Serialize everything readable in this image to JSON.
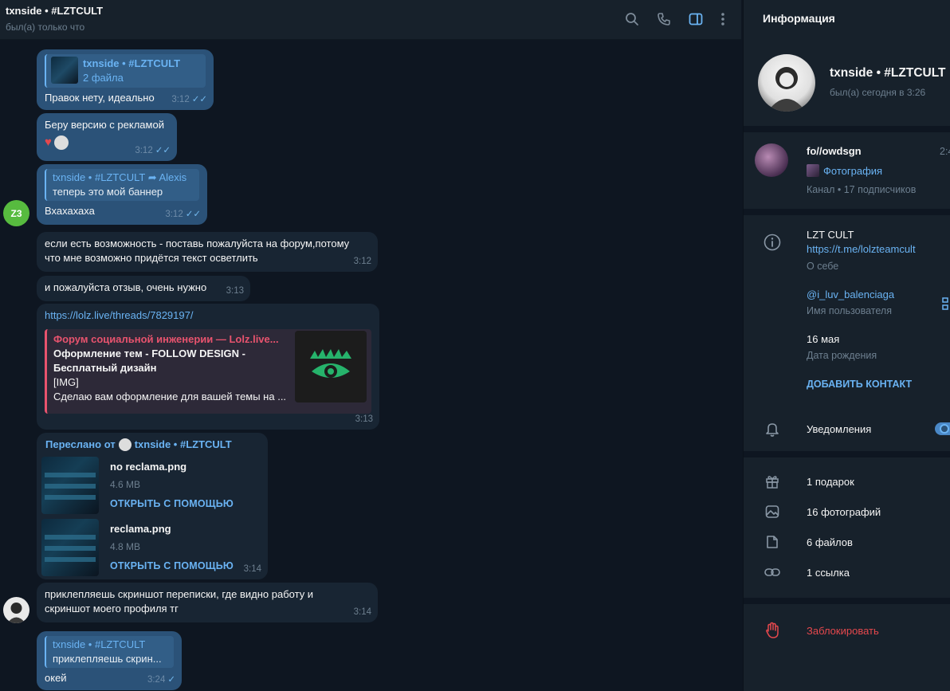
{
  "header": {
    "title": "txnside • #LZTCULT",
    "status": "был(а) только что"
  },
  "messages": {
    "m1": {
      "reply_name": "txnside • #LZTCULT",
      "reply_text": "2 файла",
      "text": "Правок нету, идеально",
      "time": "3:12"
    },
    "m2": {
      "text": "Беру версию с рекламой",
      "time": "3:12",
      "reaction": "♥"
    },
    "m3": {
      "reply_name": "txnside • #LZTCULT",
      "reply_arrow": "➦",
      "reply_to": "Alexis",
      "reply_text": "теперь это мой баннер",
      "text": "Вхахахаха",
      "time": "3:12",
      "avatar": "Z3"
    },
    "m4": {
      "text_line1": "если есть возможность - поставь пожалуйста на форум,потому",
      "text_line2": "что мне возможно придётся текст осветлить",
      "time": "3:12"
    },
    "m5": {
      "text": "и пожалуйста отзыв, очень нужно",
      "time": "3:13"
    },
    "m6": {
      "url": "https://lolz.live/threads/7829197/",
      "site": "Форум социальной инженерии — Lolz.live...",
      "title_line1": "Оформление тем - FOLLOW DESIGN -",
      "title_line2": "Бесплатный дизайн",
      "line3": "[IMG]",
      "line4": "Сделаю вам оформление для вашей темы на ...",
      "time": "3:13"
    },
    "m7": {
      "forward_prefix": "Переслано от",
      "forward_name": "txnside • #LZTCULT",
      "files": [
        {
          "name": "no reclama.png",
          "size": "4.6 MB",
          "action": "ОТКРЫТЬ С ПОМОЩЬЮ"
        },
        {
          "name": "reclama.png",
          "size": "4.8 MB",
          "action": "ОТКРЫТЬ С ПОМОЩЬЮ"
        }
      ],
      "time": "3:14"
    },
    "m8": {
      "text_line1": "приклепляешь скриншот переписки, где видно работу и",
      "text_line2": "скриншот моего профиля тг",
      "time": "3:14"
    },
    "m9": {
      "reply_name": "txnside • #LZTCULT",
      "reply_text": "приклепляешь скрин...",
      "text": "окей",
      "time": "3:24"
    }
  },
  "info": {
    "header": "Информация",
    "name": "txnside • #LZTCULT",
    "status": "был(а) сегодня в 3:26",
    "channel": {
      "name": "fo//owdsgn",
      "time": "2:4",
      "post": "Фотография",
      "meta": "Канал • 17 подписчиков"
    },
    "about": {
      "text": "LZT CULT",
      "link": "https://t.me/lolzteamcult",
      "label": "О себе"
    },
    "username": {
      "value": "@i_luv_balenciaga",
      "label": "Имя пользователя"
    },
    "birthday": {
      "value": "16 мая",
      "label": "Дата рождения"
    },
    "add_contact": "ДОБАВИТЬ КОНТАКТ",
    "notifications": "Уведомления",
    "media": {
      "gifts": "1 подарок",
      "photos": "16 фотографий",
      "files": "6 файлов",
      "links": "1 ссылка"
    },
    "block": "Заблокировать"
  },
  "colors": {
    "accent": "#6ab3f3",
    "outgoing": "#2b5278",
    "incoming": "#182533",
    "danger": "#e5484d",
    "preview_accent": "#e8536e"
  }
}
